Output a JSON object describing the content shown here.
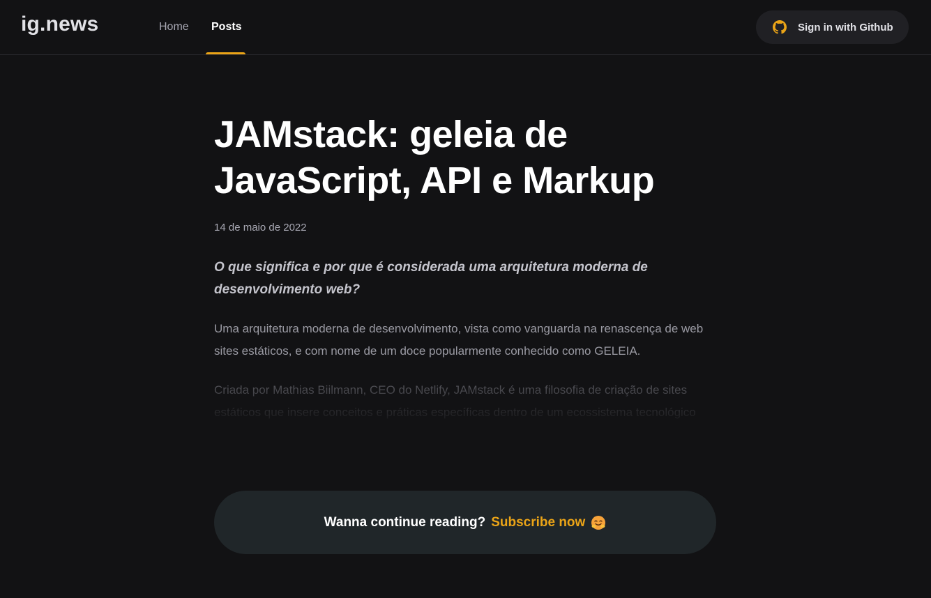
{
  "header": {
    "logo": "ig.news",
    "nav": [
      {
        "label": "Home",
        "active": false
      },
      {
        "label": "Posts",
        "active": true
      }
    ],
    "signin_label": "Sign in with Github",
    "signin_icon": "github-icon"
  },
  "post": {
    "title": "JAMstack: geleia de JavaScript, API e Markup",
    "date": "14 de maio de 2022",
    "subtitle": "O que significa e por que é considerada uma arquitetura moderna de desenvolvimento web?",
    "paragraphs": [
      "Uma arquitetura moderna de desenvolvimento, vista como vanguarda na renascença de web sites estáticos, e com nome de um doce popularmente conhecido como GELEIA.",
      "Criada por Mathias Biilmann, CEO do Netlify, JAMstack é uma filosofia de criação de sites estáticos que insere conceitos e práticas específicas dentro de um ecossistema tecnológico"
    ]
  },
  "cta": {
    "text": "Wanna continue reading?",
    "link_label": "Subscribe now",
    "emoji_icon": "hugging-face-emoji-icon"
  },
  "colors": {
    "background": "#121214",
    "accent": "#eba417",
    "button_bg": "#202024",
    "cta_bg": "#202629",
    "title": "#ffffff",
    "muted": "#a8a8b3"
  }
}
